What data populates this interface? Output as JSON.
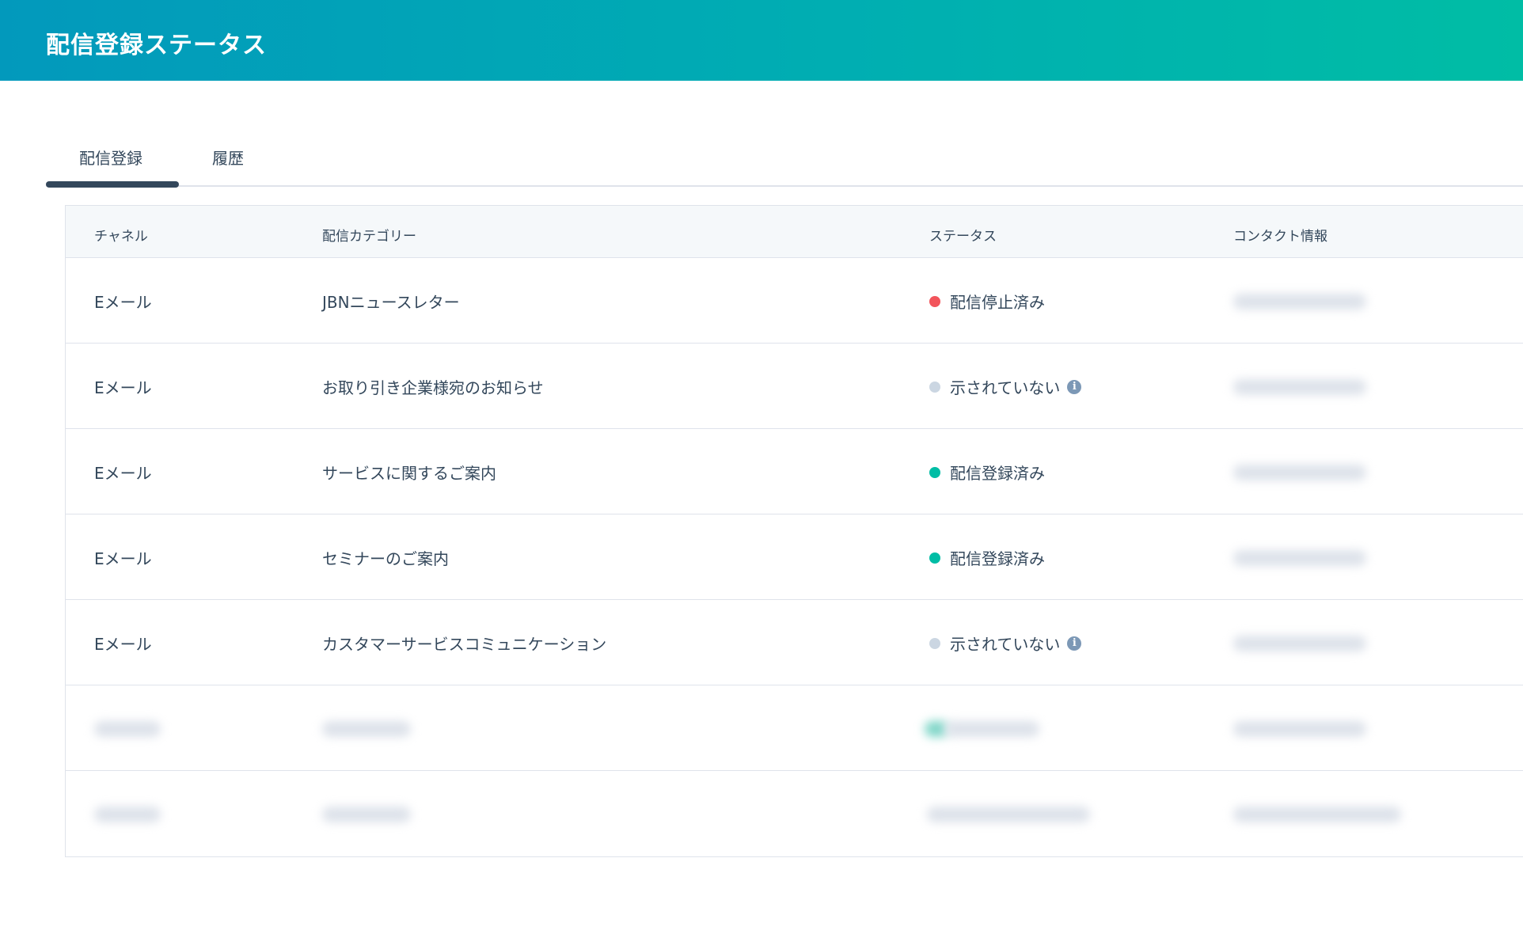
{
  "header": {
    "title": "配信登録ステータス"
  },
  "tabs": [
    {
      "label": "配信登録",
      "active": true
    },
    {
      "label": "履歴",
      "active": false
    }
  ],
  "table": {
    "columns": [
      "チャネル",
      "配信カテゴリー",
      "ステータス",
      "コンタクト情報"
    ],
    "rows": [
      {
        "channel": "Eメール",
        "category": "JBNニュースレター",
        "status": "配信停止済み",
        "status_color": "#f2545b",
        "info": false
      },
      {
        "channel": "Eメール",
        "category": "お取り引き企業様宛のお知らせ",
        "status": "示されていない",
        "status_color": "#cbd6e2",
        "info": true
      },
      {
        "channel": "Eメール",
        "category": "サービスに関するご案内",
        "status": "配信登録済み",
        "status_color": "#00bda5",
        "info": false
      },
      {
        "channel": "Eメール",
        "category": "セミナーのご案内",
        "status": "配信登録済み",
        "status_color": "#00bda5",
        "info": false
      },
      {
        "channel": "Eメール",
        "category": "カスタマーサービスコミュニケーション",
        "status": "示されていない",
        "status_color": "#cbd6e2",
        "info": true
      }
    ]
  },
  "icons": {
    "status_dot": "status-dot-icon",
    "info": "info-icon"
  }
}
